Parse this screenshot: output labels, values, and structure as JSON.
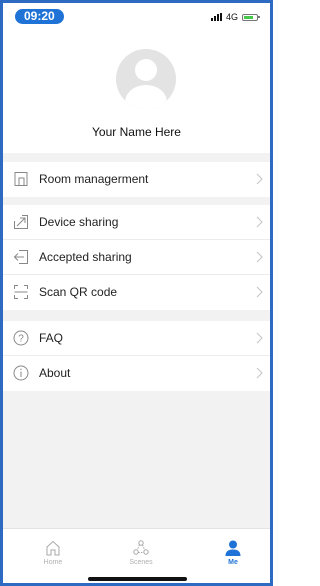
{
  "status_bar": {
    "time": "09:20",
    "network": "4G"
  },
  "profile": {
    "name": "Your Name Here"
  },
  "menu_groups": [
    {
      "items": [
        {
          "label": "Room managerment",
          "icon": "room-icon"
        }
      ]
    },
    {
      "items": [
        {
          "label": "Device sharing",
          "icon": "share-out-icon"
        },
        {
          "label": "Accepted sharing",
          "icon": "share-in-icon"
        },
        {
          "label": "Scan QR code",
          "icon": "scan-icon"
        }
      ]
    },
    {
      "items": [
        {
          "label": "FAQ",
          "icon": "question-icon"
        },
        {
          "label": "About",
          "icon": "info-icon"
        }
      ]
    }
  ],
  "tabbar": {
    "tabs": [
      {
        "label": "Home",
        "icon": "home-icon",
        "active": false
      },
      {
        "label": "Scenes",
        "icon": "scenes-icon",
        "active": false
      },
      {
        "label": "Me",
        "icon": "person-icon",
        "active": true
      }
    ]
  },
  "colors": {
    "accent": "#1f73d6",
    "frame": "#2d6bc2",
    "background": "#f2f2f2"
  }
}
